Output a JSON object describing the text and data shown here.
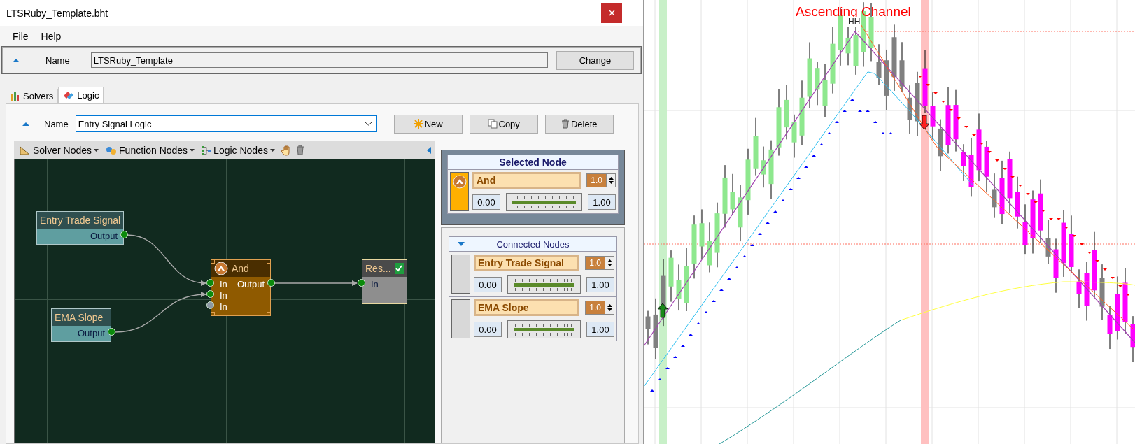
{
  "window": {
    "title": "LTSRuby_Template.bht"
  },
  "menu": [
    "File",
    "Help"
  ],
  "template": {
    "name_label": "Name",
    "name_value": "LTSRuby_Template",
    "button": "Change"
  },
  "tabs": [
    {
      "label": "Solvers",
      "selected": false
    },
    {
      "label": "Logic",
      "selected": true
    }
  ],
  "logic": {
    "name_label": "Name",
    "name_value": "Entry Signal Logic",
    "buttons": [
      "New",
      "Copy",
      "Delete"
    ]
  },
  "toolbar": {
    "menus": [
      "Solver Nodes",
      "Function Nodes",
      "Logic Nodes"
    ]
  },
  "graph": {
    "nodes": [
      {
        "kind": "source",
        "title": "Entry Trade Signal",
        "selected": false,
        "output": "Output"
      },
      {
        "kind": "source",
        "title": "EMA Slope",
        "selected": false,
        "output": "Output"
      },
      {
        "kind": "logic",
        "title": "And",
        "selected": true,
        "inputs": [
          {
            "label": "In",
            "connected": true
          },
          {
            "label": "In",
            "connected": true
          },
          {
            "label": "In",
            "connected": false
          }
        ],
        "output": "Output"
      },
      {
        "kind": "result",
        "title": "Res...",
        "selected": false,
        "checked": true,
        "inputs": [
          {
            "label": "In",
            "connected": true
          }
        ]
      }
    ]
  },
  "selected_node": {
    "header": "Selected Node",
    "name": "And",
    "weight": "1.0",
    "min": "0.00",
    "max": "1.00",
    "level": 1
  },
  "connected_nodes": {
    "header": "Connected Nodes",
    "items": [
      {
        "name": "Entry Trade Signal",
        "weight": "1.0",
        "min": "0.00",
        "max": "1.00",
        "level": 1
      },
      {
        "name": "EMA Slope",
        "weight": "1.0",
        "min": "0.00",
        "max": "1.00",
        "level": 1
      }
    ]
  },
  "chart": {
    "title": "Ascending Channel",
    "peak_label": "HH"
  }
}
